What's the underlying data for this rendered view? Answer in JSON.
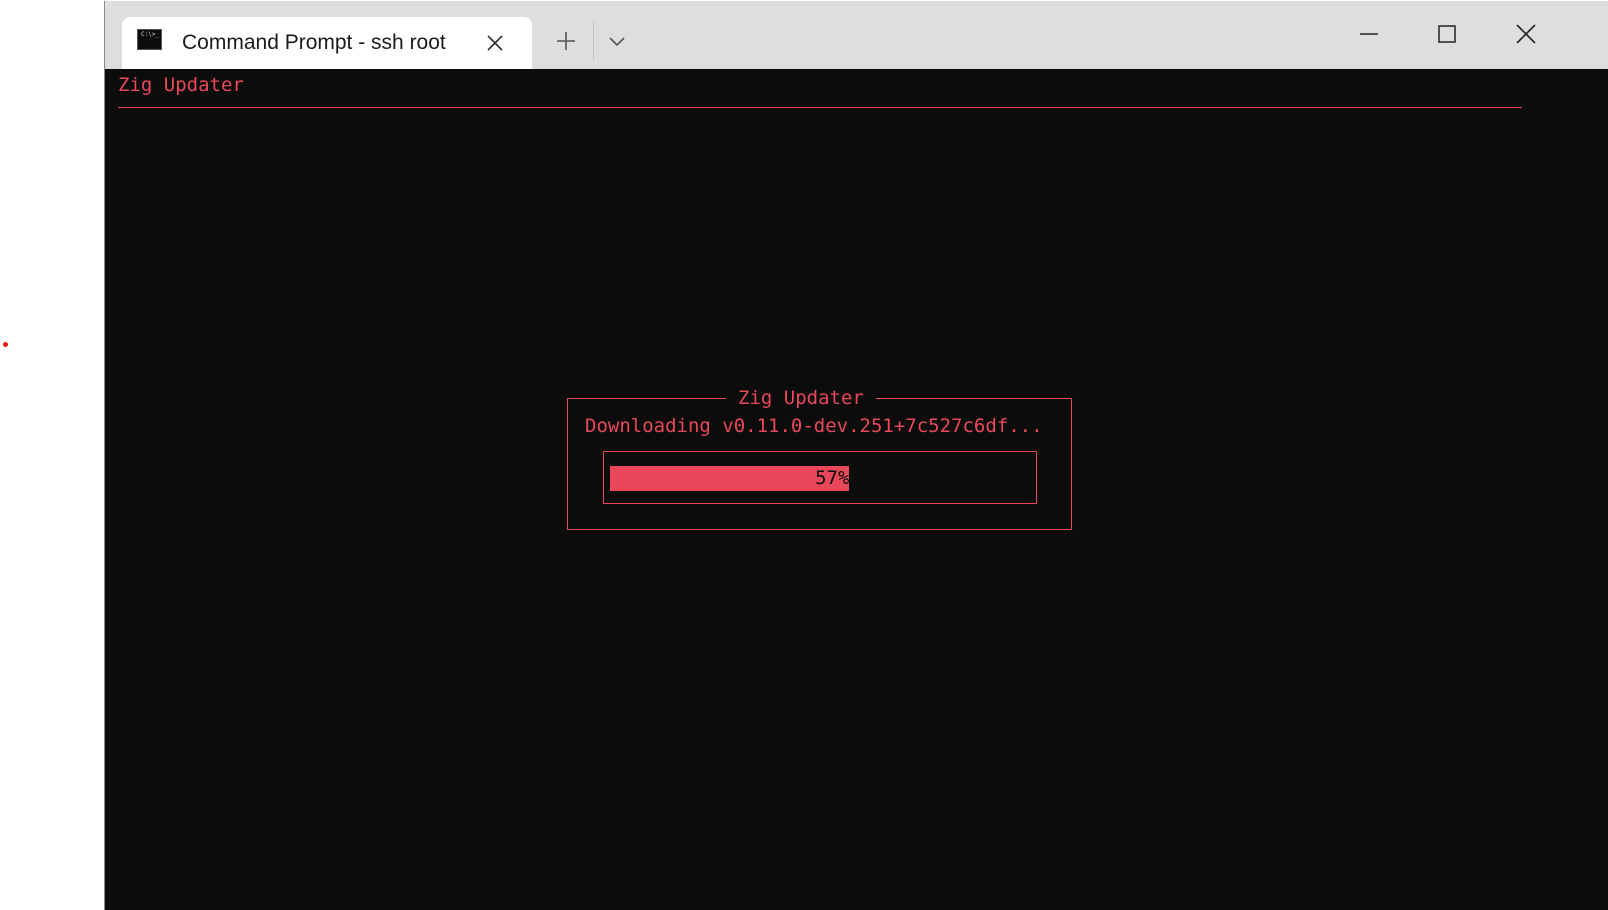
{
  "window": {
    "tab_title": "Command Prompt - ssh  root",
    "tab_icon": "cmd-icon",
    "tab_icon_glyph": "C:\\>_",
    "new_tab_icon": "plus-icon",
    "dropdown_icon": "chevron-down-icon",
    "controls": [
      "minimize-icon",
      "maximize-icon",
      "close-icon"
    ]
  },
  "terminal": {
    "header": "Zig Updater",
    "text_color": "#e8485a",
    "background_color": "#0c0c0c",
    "dialog": {
      "title": "Zig Updater",
      "message": "Downloading v0.11.0-dev.251+7c527c6df...",
      "progress": {
        "percent": 57,
        "label": "57%"
      }
    }
  }
}
